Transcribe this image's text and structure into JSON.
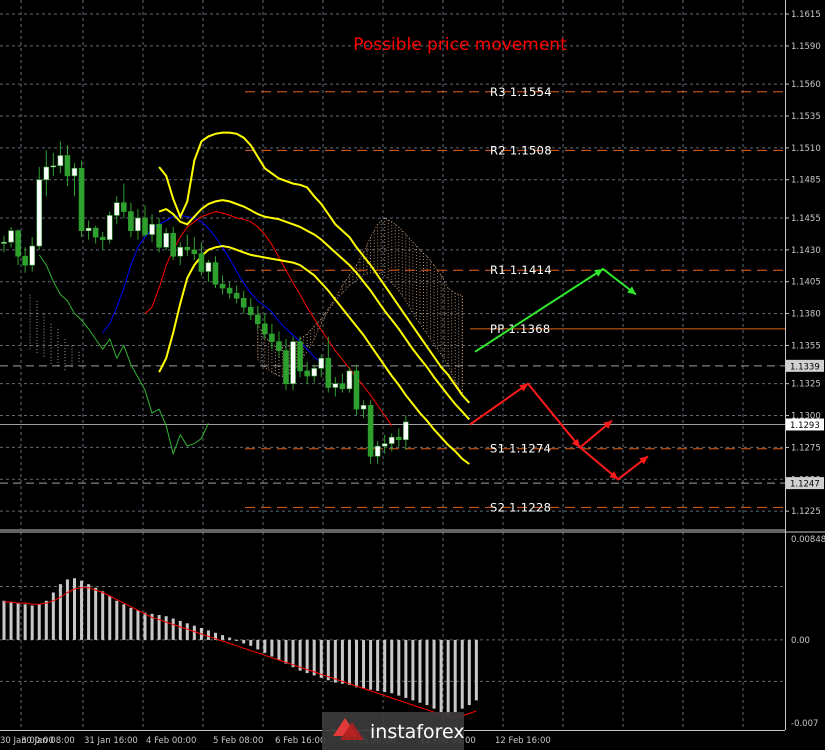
{
  "colors": {
    "background": "#000000",
    "grid": "#5f6b77",
    "candle_up": "#ffffff",
    "candle_down": "#2ea02e",
    "bollinger": "#ffff00",
    "fast_ma": "#ff0000",
    "slow_ma": "#0000ff",
    "lagging_span": "#32b432",
    "level_line": "#e06018",
    "cloud": "#d8a880",
    "arrow_up_scenario": "#2ee82e",
    "arrow_down_scenario": "#ff1a1a",
    "histogram": "#c8c8c8",
    "signal_line": "#ff0000"
  },
  "chart_data": [
    {
      "type": "candlestick",
      "title": "Possible price movement",
      "y_ticks": [
        1.1615,
        1.159,
        1.156,
        1.1535,
        1.151,
        1.1485,
        1.1455,
        1.143,
        1.1405,
        1.138,
        1.1355,
        1.1325,
        1.13,
        1.1275,
        1.125,
        1.1225
      ],
      "ylim": [
        1.1211,
        1.1626
      ],
      "x_ticks": [
        "30 Jan 00:00",
        "30 Jan 08:00",
        "31 Jan 16:00",
        "4 Feb 00:00",
        "5 Feb 08:00",
        "6 Feb 16:00",
        "8 Feb 00:00",
        "11 Feb 08:00",
        "12 Feb 16:00"
      ],
      "grid": true,
      "levels": [
        {
          "label": "R3",
          "value": "1.1554",
          "y": 1.1554,
          "solid": false
        },
        {
          "label": "R2",
          "value": "1.1508",
          "y": 1.1508,
          "solid": false
        },
        {
          "label": "R1",
          "value": "1.1414",
          "y": 1.1414,
          "solid": false
        },
        {
          "label": "PP",
          "value": "1.1368",
          "y": 1.1368,
          "solid": true
        },
        {
          "label": "S1",
          "value": "1.1274",
          "y": 1.1274,
          "solid": false
        },
        {
          "label": "S2",
          "value": "1.1228",
          "y": 1.1228,
          "solid": false
        }
      ],
      "price_tags": [
        {
          "label": "1.1339",
          "y": 1.1339,
          "style": "light"
        },
        {
          "label": "1.1293",
          "y": 1.1293,
          "style": "white"
        },
        {
          "label": "1.1247",
          "y": 1.1247,
          "style": "light"
        }
      ],
      "extra_lines": [
        {
          "y": 1.1339,
          "dashed": true
        },
        {
          "y": 1.1293,
          "dashed": false
        },
        {
          "y": 1.1247,
          "dashed": true
        }
      ],
      "candles": [
        [
          1.1435,
          1.1441,
          1.1428,
          1.1436
        ],
        [
          1.1436,
          1.1448,
          1.1432,
          1.1445
        ],
        [
          1.1445,
          1.1446,
          1.1418,
          1.1425
        ],
        [
          1.1425,
          1.1432,
          1.1412,
          1.1418
        ],
        [
          1.1418,
          1.144,
          1.1413,
          1.1433
        ],
        [
          1.1433,
          1.1495,
          1.143,
          1.1485
        ],
        [
          1.1485,
          1.1508,
          1.1472,
          1.1495
        ],
        [
          1.1495,
          1.1506,
          1.1488,
          1.1496
        ],
        [
          1.1496,
          1.1515,
          1.149,
          1.1504
        ],
        [
          1.1504,
          1.1512,
          1.148,
          1.1488
        ],
        [
          1.1488,
          1.1498,
          1.1472,
          1.1494
        ],
        [
          1.1494,
          1.15,
          1.144,
          1.1445
        ],
        [
          1.1445,
          1.1453,
          1.1438,
          1.1447
        ],
        [
          1.1447,
          1.1449,
          1.1435,
          1.144
        ],
        [
          1.144,
          1.1444,
          1.143,
          1.1438
        ],
        [
          1.1438,
          1.146,
          1.1435,
          1.1457
        ],
        [
          1.1457,
          1.1472,
          1.145,
          1.1467
        ],
        [
          1.1467,
          1.1482,
          1.1455,
          1.146
        ],
        [
          1.146,
          1.1467,
          1.144,
          1.1445
        ],
        [
          1.1445,
          1.1462,
          1.1438,
          1.1455
        ],
        [
          1.1455,
          1.1465,
          1.144,
          1.1442
        ],
        [
          1.1442,
          1.1458,
          1.1436,
          1.145
        ],
        [
          1.145,
          1.1455,
          1.1428,
          1.1432
        ],
        [
          1.1432,
          1.1447,
          1.143,
          1.1443
        ],
        [
          1.1443,
          1.1448,
          1.1422,
          1.1425
        ],
        [
          1.1425,
          1.1436,
          1.1418,
          1.1432
        ],
        [
          1.1432,
          1.1442,
          1.1425,
          1.143
        ],
        [
          1.143,
          1.144,
          1.1422,
          1.1427
        ],
        [
          1.1427,
          1.1436,
          1.141,
          1.1413
        ],
        [
          1.1413,
          1.1422,
          1.1405,
          1.142
        ],
        [
          1.142,
          1.1425,
          1.14,
          1.1403
        ],
        [
          1.1403,
          1.141,
          1.1395,
          1.14
        ],
        [
          1.14,
          1.1405,
          1.1392,
          1.1396
        ],
        [
          1.1396,
          1.1402,
          1.1388,
          1.1392
        ],
        [
          1.1392,
          1.1398,
          1.138,
          1.1385
        ],
        [
          1.1385,
          1.1392,
          1.1375,
          1.1379
        ],
        [
          1.1379,
          1.1386,
          1.1368,
          1.1372
        ],
        [
          1.1372,
          1.138,
          1.136,
          1.1364
        ],
        [
          1.1364,
          1.1372,
          1.1352,
          1.1358
        ],
        [
          1.1358,
          1.1366,
          1.1346,
          1.1351
        ],
        [
          1.1351,
          1.136,
          1.132,
          1.1325
        ],
        [
          1.1325,
          1.1362,
          1.132,
          1.1358
        ],
        [
          1.1358,
          1.1362,
          1.133,
          1.1335
        ],
        [
          1.1335,
          1.1342,
          1.1325,
          1.1331
        ],
        [
          1.1331,
          1.134,
          1.1326,
          1.1337
        ],
        [
          1.1337,
          1.1348,
          1.133,
          1.1345
        ],
        [
          1.1345,
          1.1362,
          1.1318,
          1.1322
        ],
        [
          1.1322,
          1.133,
          1.1315,
          1.1325
        ],
        [
          1.1325,
          1.1333,
          1.1318,
          1.1321
        ],
        [
          1.1321,
          1.1338,
          1.1318,
          1.1335
        ],
        [
          1.1335,
          1.134,
          1.13,
          1.1305
        ],
        [
          1.1305,
          1.1312,
          1.1298,
          1.1308
        ],
        [
          1.1308,
          1.1312,
          1.1262,
          1.1268
        ],
        [
          1.1268,
          1.128,
          1.1262,
          1.1276
        ],
        [
          1.1276,
          1.1285,
          1.127,
          1.1278
        ],
        [
          1.1278,
          1.1286,
          1.1272,
          1.1283
        ],
        [
          1.1283,
          1.129,
          1.1275,
          1.1281
        ],
        [
          1.1281,
          1.13,
          1.1273,
          1.1295
        ]
      ],
      "bollinger_upper": [
        1.1495,
        1.1488,
        1.147,
        1.1456,
        1.1468,
        1.15,
        1.1515,
        1.1519,
        1.1521,
        1.1522,
        1.1522,
        1.1521,
        1.1518,
        1.1512,
        1.1503,
        1.1494,
        1.149,
        1.1486,
        1.1484,
        1.1482,
        1.1481,
        1.1479,
        1.1472,
        1.1466,
        1.1458,
        1.145,
        1.1445,
        1.144,
        1.1432,
        1.1425,
        1.1418,
        1.141,
        1.1402,
        1.1394,
        1.1386,
        1.1378,
        1.137,
        1.1362,
        1.1354,
        1.1346,
        1.1338,
        1.1332,
        1.1324,
        1.1316,
        1.131
      ],
      "bollinger_mid": [
        1.146,
        1.1462,
        1.1458,
        1.1452,
        1.145,
        1.1456,
        1.1462,
        1.1466,
        1.1468,
        1.1469,
        1.1468,
        1.1466,
        1.1464,
        1.1461,
        1.1458,
        1.1456,
        1.1455,
        1.1454,
        1.1452,
        1.145,
        1.1448,
        1.1445,
        1.1442,
        1.1438,
        1.1433,
        1.1428,
        1.1423,
        1.1418,
        1.1412,
        1.1405,
        1.1398,
        1.139,
        1.1382,
        1.1375,
        1.1368,
        1.136,
        1.1352,
        1.1345,
        1.1338,
        1.133,
        1.1323,
        1.1316,
        1.1309,
        1.1303,
        1.1297
      ],
      "bollinger_lower": [
        1.1334,
        1.1345,
        1.1365,
        1.1388,
        1.1408,
        1.1418,
        1.1425,
        1.143,
        1.1432,
        1.1433,
        1.1432,
        1.143,
        1.1428,
        1.1426,
        1.1425,
        1.1424,
        1.1423,
        1.1422,
        1.1421,
        1.142,
        1.1418,
        1.1414,
        1.141,
        1.1404,
        1.1398,
        1.1391,
        1.1384,
        1.1377,
        1.137,
        1.1363,
        1.1355,
        1.1347,
        1.1339,
        1.1331,
        1.1324,
        1.1316,
        1.1309,
        1.1302,
        1.1296,
        1.1289,
        1.1283,
        1.1277,
        1.1272,
        1.1266,
        1.1262
      ],
      "fast_ma": [
        1.138,
        1.1385,
        1.14,
        1.1418,
        1.143,
        1.144,
        1.1448,
        1.1452,
        1.1456,
        1.1458,
        1.146,
        1.1459,
        1.1457,
        1.1455,
        1.1454,
        1.1452,
        1.1448,
        1.1442,
        1.1434,
        1.1424,
        1.1414,
        1.1404,
        1.1395,
        1.1385,
        1.1376,
        1.1367,
        1.1359,
        1.1351,
        1.1344,
        1.1337,
        1.133,
        1.1323,
        1.1316,
        1.1308,
        1.13,
        1.1292
      ],
      "slow_ma": [
        1.1365,
        1.1372,
        1.1385,
        1.14,
        1.1418,
        1.1432,
        1.144,
        1.1446,
        1.145,
        1.1453,
        1.1456,
        1.1457,
        1.1456,
        1.1455,
        1.1452,
        1.1447,
        1.144,
        1.1432,
        1.1423,
        1.1413,
        1.1404,
        1.1396,
        1.139,
        1.1386,
        1.1381,
        1.1374,
        1.1368,
        1.1363,
        1.1358,
        1.1352,
        1.1346,
        1.1341
      ],
      "lagging_span": [
        1.1426,
        1.1418,
        1.1405,
        1.1395,
        1.139,
        1.138,
        1.1375,
        1.1368,
        1.136,
        1.1352,
        1.136,
        1.1345,
        1.1355,
        1.134,
        1.133,
        1.132,
        1.1302,
        1.1305,
        1.1292,
        1.127,
        1.1285,
        1.1276,
        1.1278,
        1.1282,
        1.1294
      ],
      "cloud_top": [
        1.1372,
        1.1362,
        1.1356,
        1.1353,
        1.1354,
        1.1356,
        1.136,
        1.1364,
        1.137,
        1.1376,
        1.1384,
        1.1392,
        1.1402,
        1.141,
        1.1418,
        1.1428,
        1.144,
        1.145,
        1.1455,
        1.1452,
        1.1448,
        1.1442,
        1.1436,
        1.143,
        1.1425,
        1.1418,
        1.141,
        1.14,
        1.1396,
        1.1394
      ],
      "cloud_bottom": [
        1.1344,
        1.1338,
        1.1334,
        1.1331,
        1.133,
        1.1335,
        1.1342,
        1.135,
        1.136,
        1.1372,
        1.1382,
        1.139,
        1.1396,
        1.1402,
        1.1406,
        1.141,
        1.1412,
        1.1412,
        1.141,
        1.1404,
        1.1398,
        1.139,
        1.138,
        1.1372,
        1.1364,
        1.1356,
        1.1348,
        1.134,
        1.1326,
        1.1318
      ],
      "scenario_up": [
        [
          1.135
        ],
        [
          1.1415
        ],
        [
          1.1395
        ]
      ],
      "scenario_down": [
        [
          1.1293
        ],
        [
          1.1325
        ],
        [
          1.1275
        ],
        [
          1.1296
        ],
        [
          1.125
        ],
        [
          1.1268
        ]
      ]
    },
    {
      "type": "bar",
      "y_ticks": [
        "0.00848",
        "0.00",
        "-0.007"
      ],
      "ylim": [
        -0.0076,
        0.0091
      ],
      "histogram": [
        0.0033,
        0.0032,
        0.0031,
        0.003,
        0.0029,
        0.003,
        0.0033,
        0.004,
        0.0047,
        0.0051,
        0.0052,
        0.005,
        0.0047,
        0.0044,
        0.0041,
        0.0037,
        0.0033,
        0.003,
        0.0027,
        0.0025,
        0.0023,
        0.0022,
        0.0021,
        0.002,
        0.0018,
        0.0016,
        0.0014,
        0.0012,
        0.001,
        0.0008,
        0.0006,
        0.0004,
        0.0002,
        0.0,
        -0.0003,
        -0.0005,
        -0.0008,
        -0.0011,
        -0.0014,
        -0.0017,
        -0.002,
        -0.0023,
        -0.0026,
        -0.0028,
        -0.003,
        -0.0032,
        -0.0034,
        -0.0036,
        -0.0037,
        -0.0038,
        -0.004,
        -0.0041,
        -0.0042,
        -0.0043,
        -0.0044,
        -0.0045,
        -0.0047,
        -0.0049,
        -0.0051,
        -0.0053,
        -0.0055,
        -0.0058,
        -0.0061,
        -0.0063,
        -0.0061,
        -0.0058,
        -0.0055,
        -0.0051
      ],
      "signal": [
        0.0032,
        0.0032,
        0.0031,
        0.0031,
        0.003,
        0.003,
        0.0031,
        0.0033,
        0.0036,
        0.004,
        0.0043,
        0.0044,
        0.0044,
        0.0042,
        0.004,
        0.0037,
        0.0034,
        0.0031,
        0.0028,
        0.0025,
        0.0022,
        0.0019,
        0.0017,
        0.0015,
        0.0013,
        0.0011,
        0.0009,
        0.0007,
        0.0005,
        0.0003,
        0.0001,
        -0.0001,
        -0.0003,
        -0.0005,
        -0.0007,
        -0.0009,
        -0.0011,
        -0.0013,
        -0.0015,
        -0.0017,
        -0.0019,
        -0.0021,
        -0.0023,
        -0.0025,
        -0.0027,
        -0.0029,
        -0.0031,
        -0.0033,
        -0.0035,
        -0.0037,
        -0.0039,
        -0.0041,
        -0.0043,
        -0.0045,
        -0.0047,
        -0.0049,
        -0.0051,
        -0.0053,
        -0.0055,
        -0.0057,
        -0.0059,
        -0.0061,
        -0.0063,
        -0.0065,
        -0.0065,
        -0.0064,
        -0.0062,
        -0.006
      ]
    }
  ],
  "watermark": "instaforex"
}
